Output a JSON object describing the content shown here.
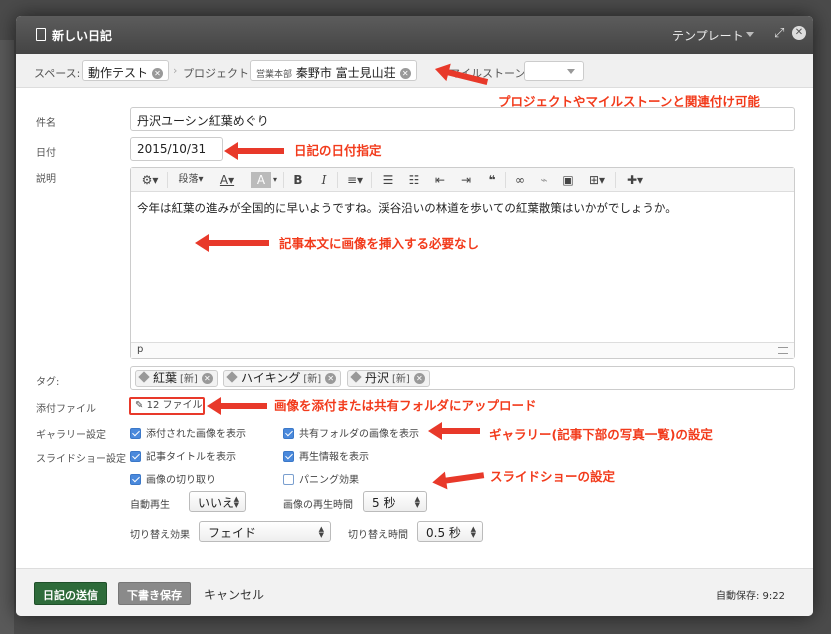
{
  "modal": {
    "title": "新しい日記",
    "template_label": "テンプレート"
  },
  "crumbs": {
    "space_label": "スペース:",
    "space_value": "動作テスト",
    "project_label": "プロジェクト",
    "project_prefix": "営業本部",
    "project_value": "秦野市 富士見山荘",
    "milestone_label": "マイルストーン"
  },
  "form": {
    "subject_label": "件名",
    "subject_value": "丹沢ユーシン紅葉めぐり",
    "date_label": "日付",
    "date_value": "2015/10/31",
    "body_label": "説明",
    "body_text": "今年は紅葉の進みが全国的に早いようですね。渓谷沿いの林道を歩いての紅葉散策はいかがでしょうか。",
    "status_tag": "p",
    "tags_label": "タグ:",
    "tags": [
      {
        "name": "紅葉",
        "badge": "[新]"
      },
      {
        "name": "ハイキング",
        "badge": "[新]"
      },
      {
        "name": "丹沢",
        "badge": "[新]"
      }
    ],
    "attach_label": "添付ファイル",
    "attach_value": "12 ファイル",
    "gallery_label": "ギャラリー設定",
    "gallery_opt1": "添付された画像を表示",
    "gallery_opt2": "共有フォルダの画像を表示",
    "slideshow_label": "スライドショー設定",
    "ss_opt1": "記事タイトルを表示",
    "ss_opt2": "再生情報を表示",
    "ss_opt3": "画像の切り取り",
    "ss_opt4": "パニング効果",
    "autoplay_label": "自動再生",
    "autoplay_value": "いいえ",
    "duration_label": "画像の再生時間",
    "duration_value": "5 秒",
    "effect_label": "切り替え効果",
    "effect_value": "フェイド",
    "switch_time_label": "切り替え時間",
    "switch_time_value": "0.5 秒"
  },
  "toolbar": {
    "paragraph_label": "段落"
  },
  "footer": {
    "submit_label": "日記の送信",
    "draft_label": "下書き保存",
    "cancel_label": "キャンセル",
    "autosave": "自動保存: 9:22"
  },
  "annotations": {
    "a1": "プロジェクトやマイルストーンと関連付け可能",
    "a2": "日記の日付指定",
    "a3": "記事本文に画像を挿入する必要なし",
    "a4": "画像を添付または共有フォルダにアップロード",
    "a5": "ギャラリー(記事下部の写真一覧)の設定",
    "a6": "スライドショーの設定"
  },
  "colors": {
    "annotation": "#e8392a",
    "primary_button": "#2e6b3a",
    "checkbox": "#4a89dc"
  }
}
